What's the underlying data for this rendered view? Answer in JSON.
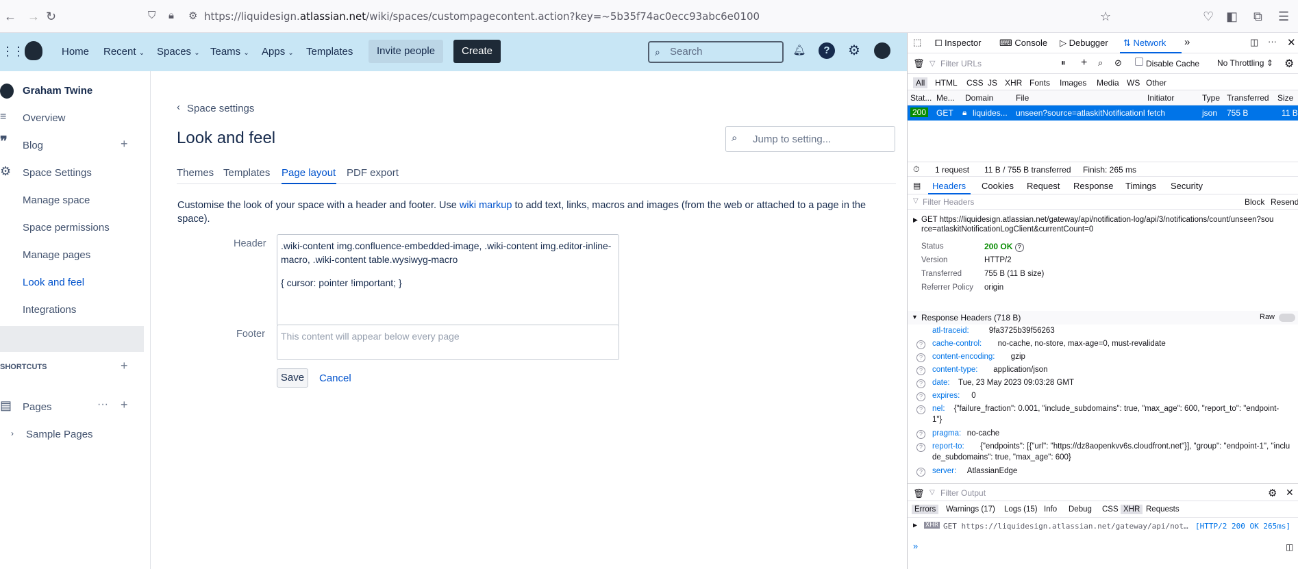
{
  "browser": {
    "url_prefix": "https://liquidesign.",
    "url_domain": "atlassian.net",
    "url_suffix": "/wiki/spaces/custompagecontent.action?key=~5b35f74ac0ecc93abc6e0100"
  },
  "nav": {
    "home": "Home",
    "recent": "Recent",
    "spaces": "Spaces",
    "teams": "Teams",
    "apps": "Apps",
    "templates": "Templates",
    "invite": "Invite people",
    "create": "Create",
    "search_placeholder": "Search"
  },
  "sidebar": {
    "user": "Graham Twine",
    "items": [
      {
        "label": "Overview"
      },
      {
        "label": "Blog"
      },
      {
        "label": "Space Settings"
      },
      {
        "label": "Manage space"
      },
      {
        "label": "Space permissions"
      },
      {
        "label": "Manage pages"
      },
      {
        "label": "Look and feel"
      },
      {
        "label": "Integrations"
      }
    ],
    "shortcuts": "SHORTCUTS",
    "pages": "Pages",
    "sample_pages": "Sample Pages"
  },
  "main": {
    "back": "Space settings",
    "title": "Look and feel",
    "jump_placeholder": "Jump to setting...",
    "tabs": [
      "Themes",
      "Templates",
      "Page layout",
      "PDF export"
    ],
    "desc_pre": "Customise the look of your space with a header and footer. Use ",
    "desc_link": "wiki markup",
    "desc_post": " to add text, links, macros and images (from the web or attached to a page in the space).",
    "header_label": "Header",
    "header_line1": ".wiki-content img.confluence-embedded-image, .wiki-content img.editor-inline-macro, .wiki-content table.wysiwyg-macro",
    "header_line2": "{ cursor: pointer !important; }",
    "footer_label": "Footer",
    "footer_placeholder": "This content will appear below every page",
    "save": "Save",
    "cancel": "Cancel"
  },
  "devtools": {
    "tabs": [
      "Inspector",
      "Console",
      "Debugger",
      "Network"
    ],
    "filter_urls": "Filter URLs",
    "disable_cache": "Disable Cache",
    "throttling": "No Throttling",
    "types": [
      "All",
      "HTML",
      "CSS",
      "JS",
      "XHR",
      "Fonts",
      "Images",
      "Media",
      "WS",
      "Other"
    ],
    "columns": [
      "Stat...",
      "Me...",
      "Domain",
      "File",
      "Initiator",
      "Type",
      "Transferred",
      "Size"
    ],
    "request": {
      "status": "200",
      "method": "GET",
      "domain": "liquides...",
      "file": "unseen?source=atlaskitNotificationL",
      "initiator": "fetch",
      "type": "json",
      "transferred": "755 B",
      "size": "11 B"
    },
    "summary": {
      "requests": "1 request",
      "transferred": "11 B / 755 B transferred",
      "finish": "Finish: 265 ms"
    },
    "detail_tabs": [
      "Headers",
      "Cookies",
      "Request",
      "Response",
      "Timings",
      "Security"
    ],
    "filter_headers": "Filter Headers",
    "block": "Block",
    "resend": "Resend",
    "get_url1": "GET https://liquidesign.atlassian.net/gateway/api/notification-log/api/3/notifications/count/unseen?sou",
    "get_url2": "rce=atlaskitNotificationLogClient&currentCount=0",
    "status_label": "Status",
    "status_value": "200 OK",
    "version_label": "Version",
    "version_value": "HTTP/2",
    "transferred_label": "Transferred",
    "transferred_value": "755 B (11 B size)",
    "referrer_label": "Referrer Policy",
    "referrer_value": "origin",
    "resp_headers": "Response Headers (718 B)",
    "raw": "Raw",
    "headers": [
      {
        "name": "atl-traceid:",
        "value": "9fa3725b39f56263"
      },
      {
        "name": "cache-control:",
        "value": "no-cache, no-store, max-age=0, must-revalidate"
      },
      {
        "name": "content-encoding:",
        "value": "gzip"
      },
      {
        "name": "content-type:",
        "value": "application/json"
      },
      {
        "name": "date:",
        "value": "Tue, 23 May 2023 09:03:28 GMT"
      },
      {
        "name": "expires:",
        "value": "0"
      },
      {
        "name": "nel:",
        "value": "{\"failure_fraction\": 0.001, \"include_subdomains\": true, \"max_age\": 600, \"report_to\": \"endpoint-"
      },
      {
        "name": "",
        "value": "1\"}"
      },
      {
        "name": "pragma:",
        "value": "no-cache"
      },
      {
        "name": "report-to:",
        "value": "{\"endpoints\": [{\"url\": \"https://dz8aopenkvv6s.cloudfront.net\"}], \"group\": \"endpoint-1\", \"inclu"
      },
      {
        "name": "",
        "value": "de_subdomains\": true, \"max_age\": 600}"
      },
      {
        "name": "server:",
        "value": "AtlassianEdge"
      }
    ],
    "filter_output": "Filter Output",
    "console_filters": [
      "Errors",
      "Warnings (17)",
      "Logs (15)",
      "Info",
      "Debug",
      "CSS",
      "XHR",
      "Requests"
    ],
    "log_line": "GET https://liquidesign.atlassian.net/gateway/api/not…",
    "log_status": "[HTTP/2 200 OK 265ms]"
  }
}
